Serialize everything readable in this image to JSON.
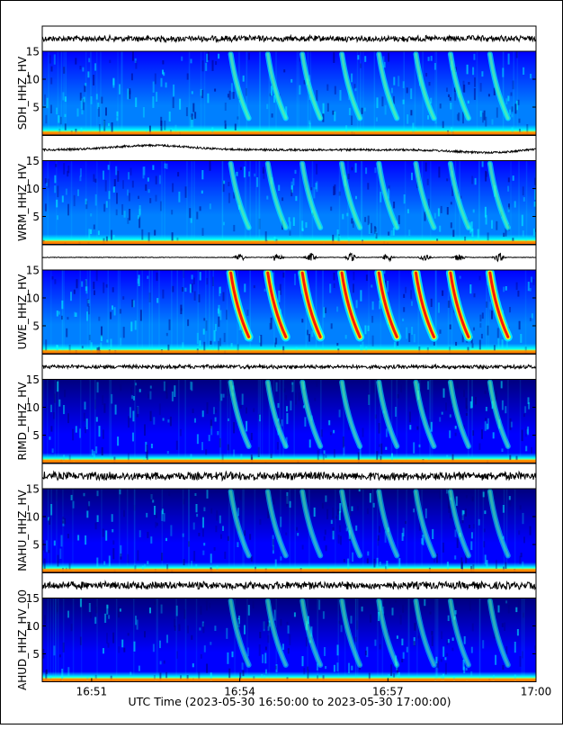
{
  "chart_data": {
    "type": "heatmap",
    "xlabel": "UTC Time (2023-05-30 16:50:00 to 2023-05-30 17:00:00)",
    "x_range": [
      "16:50:00",
      "17:00:00"
    ],
    "x_ticks": [
      "16:51",
      "16:54",
      "16:57",
      "17:00"
    ],
    "x_tick_minutes": [
      1,
      4,
      7,
      10
    ],
    "y_range": [
      0,
      15
    ],
    "y_ticks": [
      5,
      10,
      15
    ],
    "colormap": [
      "#00007f",
      "#0000ff",
      "#0080ff",
      "#00ffff",
      "#80ff80",
      "#ffff00",
      "#ff8000",
      "#ff0000",
      "#800000"
    ],
    "burst_minutes": [
      4.0,
      4.75,
      5.45,
      6.25,
      7.0,
      7.75,
      8.45,
      9.25
    ],
    "stations": [
      {
        "label": "SDH_HHZ_HV",
        "intensity": 0.62,
        "waveform": "noise",
        "waveform_amp": 0.55
      },
      {
        "label": "WRM_HHZ_HV",
        "intensity": 0.55,
        "waveform": "drift",
        "waveform_amp": 0.4
      },
      {
        "label": "UWE_HHZ_HV",
        "intensity": 0.9,
        "waveform": "bursts",
        "waveform_amp": 0.85
      },
      {
        "label": "RIMD_HHZ_HV",
        "intensity": 0.42,
        "waveform": "noise",
        "waveform_amp": 0.35
      },
      {
        "label": "NAHU_HHZ_HV",
        "intensity": 0.3,
        "waveform": "noise",
        "waveform_amp": 0.75
      },
      {
        "label": "AHUD_HHZ_HV_00",
        "intensity": 0.28,
        "waveform": "noise",
        "waveform_amp": 0.7
      }
    ]
  }
}
